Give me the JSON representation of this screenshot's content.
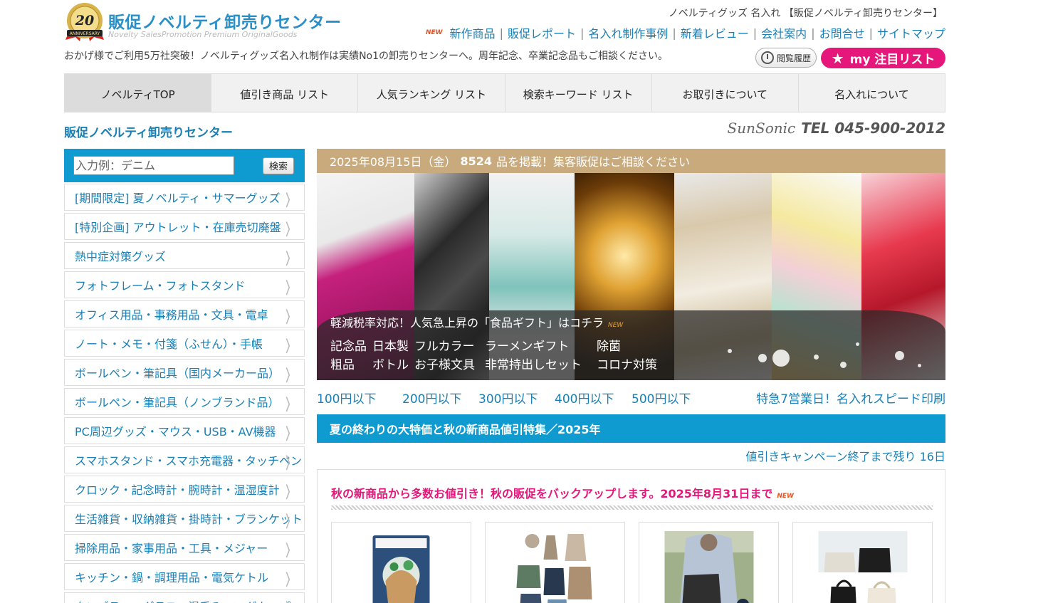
{
  "header": {
    "logo_badge": "20",
    "logo_text": "販促ノベルティ卸売りセンター",
    "logo_sub": "Novelty SalesPromotion Premium OriginalGoods",
    "site_title": "ノベルティグッズ 名入れ 【販促ノベルティ卸売りセンター】",
    "new_mark": "NEW",
    "top_links": [
      "新作商品",
      "販促レポート",
      "名入れ制作事例",
      "新着レビュー",
      "会社案内",
      "お問合せ",
      "サイトマップ"
    ],
    "tagline": "おかげ様でご利用5万社突破！ノベルティグッズ名入れ制作は実績No1の卸売りセンターへ。周年記念、卒業記念品もご相談ください。",
    "history_label": "閲覧履歴",
    "mylist_label": "my 注目リスト"
  },
  "nav": [
    "ノベルティTOP",
    "値引き商品 リスト",
    "人気ランキング リスト",
    "検索キーワード リスト",
    "お取引きについて",
    "名入れについて"
  ],
  "site_name": "販促ノベルティ卸売りセンター",
  "tel": {
    "brand": "SunSonic",
    "number": "TEL 045-900-2012"
  },
  "search": {
    "placeholder": "入力例：デニム",
    "button": "検索"
  },
  "categories": [
    "[期間限定] 夏ノベルティ・サマーグッズ",
    "[特別企画] アウトレット・在庫売切廃盤",
    "熱中症対策グッズ",
    "フォトフレーム・フォトスタンド",
    "オフィス用品・事務用品・文具・電卓",
    "ノート・メモ・付箋（ふせん）・手帳",
    "ボールペン・筆記具（国内メーカー品）",
    "ボールペン・筆記具（ノンブランド品）",
    "PC周辺グッズ・マウス・USB・AV機器",
    "スマホスタンド・スマホ充電器・タッチペン",
    "クロック・記念時計・腕時計・温湿度計",
    "生活雑貨・収納雑貨・掛時計・ブランケット",
    "掃除用品・家事用品・工具・メジャー",
    "キッチン・鍋・調理用品・電気ケトル",
    "タンブラー・グラス・湯呑み・マグカップ"
  ],
  "date_bar": {
    "date": "2025年08月15日（金）",
    "count": "8524",
    "suffix": "品を掲載！集客販促はご相談ください"
  },
  "hero": {
    "headline": "軽減税率対応！人気急上昇の「食品ギフト」はコチラ",
    "new_mark": "NEW",
    "row1": [
      "記念品",
      "日本製",
      "フルカラー",
      "ラーメンギフト",
      "除菌"
    ],
    "row2": [
      "粗品",
      "ボトル",
      "お子様文具",
      "非常持出しセット",
      "コロナ対策"
    ]
  },
  "price_links": [
    "100円以下",
    "200円以下",
    "300円以下",
    "400円以下",
    "500円以下"
  ],
  "speed_link": "特急7営業日！名入れスピード印刷",
  "campaign": {
    "title": "夏の終わりの大特価と秋の新商品値引特集／2025年",
    "remaining": "値引きキャンペーン終了まで残り 16日",
    "feature_title": "秋の新商品から多数お値引き！秋の販促をバックアップします。2025年8月31日まで",
    "new_mark": "NEW"
  },
  "colors": {
    "brand_blue": "#0f9bd0",
    "link_blue": "#1a7fb5",
    "pink": "#e6177a",
    "gold": "#c8aa7d"
  }
}
